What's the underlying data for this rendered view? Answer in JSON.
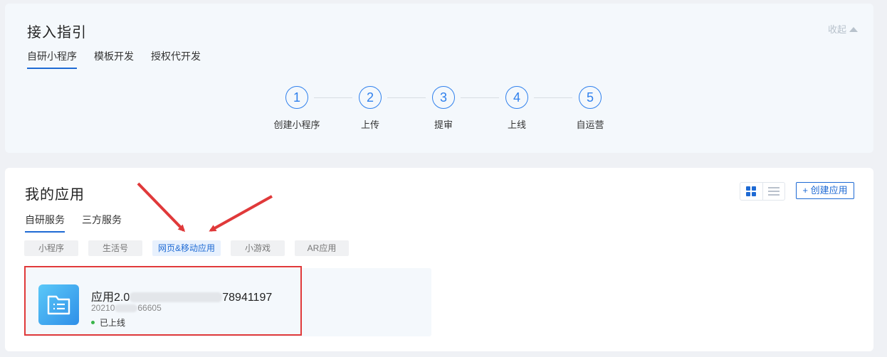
{
  "guide": {
    "title": "接入指引",
    "collapse_label": "收起",
    "tabs": [
      "自研小程序",
      "模板开发",
      "授权代开发"
    ],
    "steps": [
      {
        "num": "1",
        "label": "创建小程序"
      },
      {
        "num": "2",
        "label": "上传"
      },
      {
        "num": "3",
        "label": "提审"
      },
      {
        "num": "4",
        "label": "上线"
      },
      {
        "num": "5",
        "label": "自运营"
      }
    ]
  },
  "apps": {
    "title": "我的应用",
    "create_label": "+ 创建应用",
    "tabs": [
      "自研服务",
      "三方服务"
    ],
    "filters": [
      "小程序",
      "生活号",
      "网页&移动应用",
      "小游戏",
      "AR应用"
    ],
    "items": [
      {
        "name_prefix": "应用2.0",
        "name_suffix": "78941197",
        "id_prefix": "20210",
        "id_suffix": "66605",
        "status": "已上线"
      }
    ]
  },
  "colors": {
    "accent": "#1e6ad4",
    "annotation_red": "#e0393a",
    "status_online": "#39b54a"
  },
  "icons": {
    "collapse": "triangle-up-icon",
    "grid_view": "grid-icon",
    "list_view": "list-icon",
    "app": "document-list-icon"
  }
}
